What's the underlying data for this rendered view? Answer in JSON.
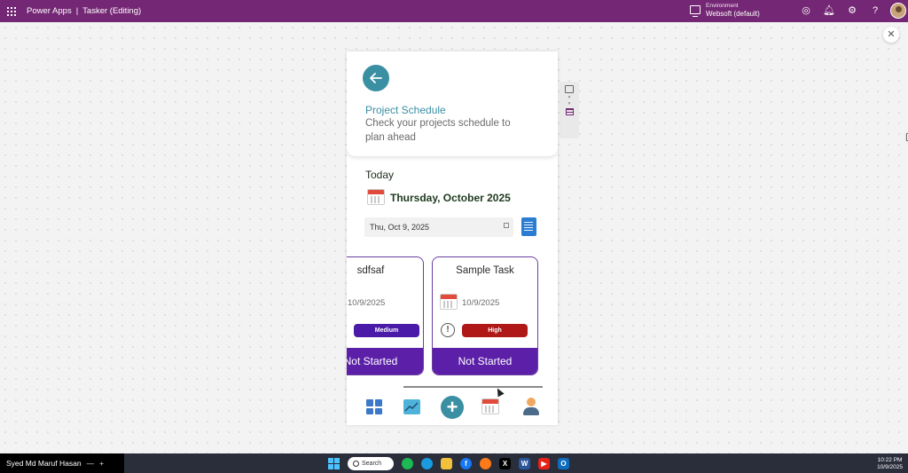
{
  "topbar": {
    "product": "Power Apps",
    "separator": "|",
    "app_name": "Tasker (Editing)",
    "environment_label": "Environment",
    "environment_name": "Websoft (default)",
    "accent": "#742774"
  },
  "app": {
    "header": {
      "title": "Project Schedule",
      "subtitle": "Check your projects schedule to plan ahead"
    },
    "today_label": "Today",
    "current_date_text": "Thursday, October 2025",
    "date_picker_value": "Thu, Oct 9, 2025",
    "tasks": [
      {
        "title": "sdfsaf",
        "date": "10/9/2025",
        "priority": "Medium",
        "priority_color": "#4a1aa8",
        "status": "Not Started"
      },
      {
        "title": "Sample Task",
        "date": "10/9/2025",
        "priority": "High",
        "priority_color": "#b01818",
        "status": "Not Started"
      }
    ],
    "bottom_nav": [
      "dashboard-icon",
      "trend-chart-icon",
      "add-icon",
      "calendar-icon",
      "user-icon"
    ],
    "colors": {
      "teal": "#3a8fa3",
      "purple": "#5b1fa8"
    }
  },
  "taskbar": {
    "user_name": "Syed Md Maruf Hasan",
    "search_placeholder": "Search",
    "time": "10:22 PM",
    "date": "10/9/2025"
  }
}
